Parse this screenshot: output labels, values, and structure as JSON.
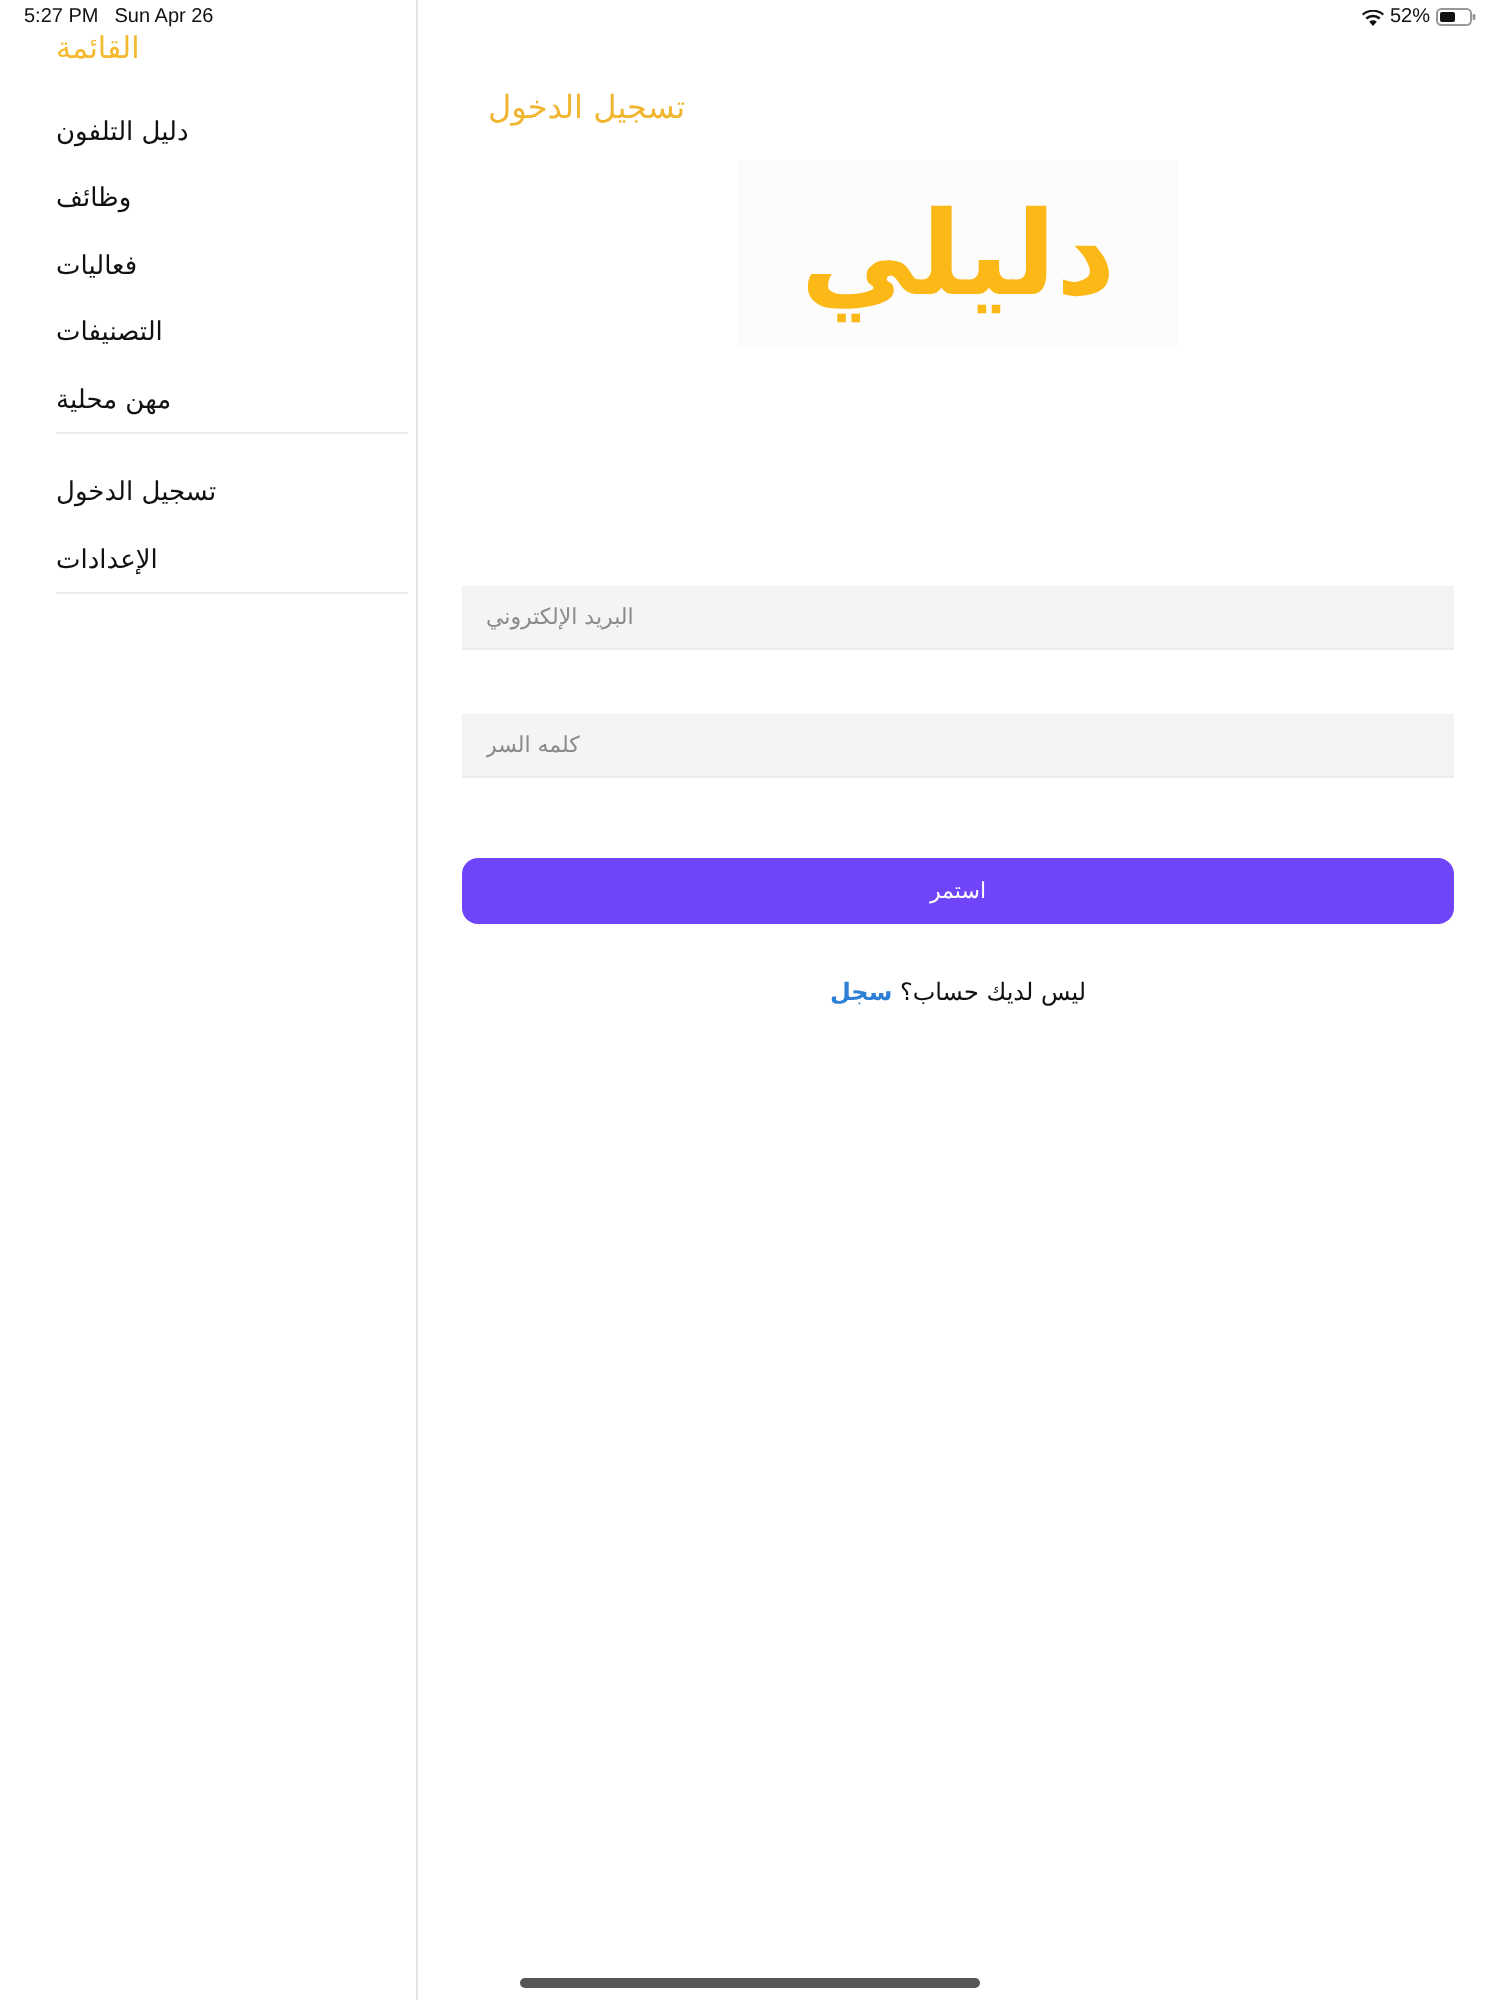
{
  "status_bar": {
    "time": "5:27 PM",
    "date": "Sun Apr 26",
    "battery_text": "52%"
  },
  "sidebar": {
    "title": "القائمة",
    "sections": [
      {
        "items": [
          {
            "label": "دليل التلفون"
          },
          {
            "label": "وظائف"
          },
          {
            "label": "فعاليات"
          },
          {
            "label": "التصنيفات"
          },
          {
            "label": "مهن محلية"
          }
        ]
      },
      {
        "items": [
          {
            "label": "تسجيل الدخول"
          },
          {
            "label": "الإعدادات"
          }
        ]
      }
    ]
  },
  "login": {
    "title": "تسجيل الدخول",
    "logo": "دليلي",
    "fields": [
      {
        "placeholder": "البريد الإلكتروني"
      },
      {
        "placeholder": "كلمه السر"
      }
    ],
    "submit": "استمر",
    "signup_prompt": "ليس لديك حساب؟",
    "signup_link": "سجل"
  }
}
